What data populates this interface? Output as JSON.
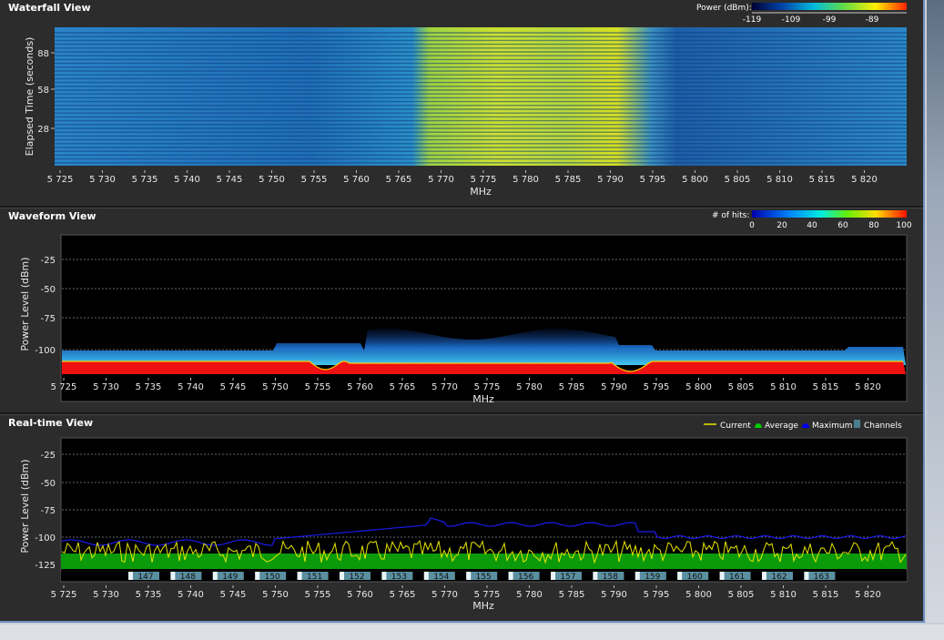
{
  "freq_ticks": [
    "5 725",
    "5 730",
    "5 735",
    "5 740",
    "5 745",
    "5 750",
    "5 755",
    "5 760",
    "5 765",
    "5 770",
    "5 775",
    "5 780",
    "5 785",
    "5 790",
    "5 795",
    "5 800",
    "5 805",
    "5 810",
    "5 815",
    "5 820"
  ],
  "waterfall": {
    "title": "Waterfall View",
    "ylabel": "Elapsed Time (seconds)",
    "xlabel": "MHz",
    "yticks": [
      "88",
      "58",
      "28"
    ],
    "legend_label": "Power (dBm):",
    "legend_ticks": [
      "-119",
      "-109",
      "-99",
      "-89"
    ]
  },
  "waveform": {
    "title": "Waveform View",
    "ylabel": "Power Level (dBm)",
    "xlabel": "MHz",
    "yticks": [
      "-25",
      "-50",
      "-75",
      "-100"
    ],
    "legend_label": "# of hits:",
    "legend_ticks": [
      "0",
      "20",
      "40",
      "60",
      "80",
      "100"
    ]
  },
  "realtime": {
    "title": "Real-time View",
    "ylabel": "Power Level (dBm)",
    "xlabel": "MHz",
    "yticks": [
      "-25",
      "-50",
      "-75",
      "-100",
      "-125"
    ],
    "legend": [
      {
        "label": "Current",
        "color": "#e6e600"
      },
      {
        "label": "Average",
        "color": "#00cc00"
      },
      {
        "label": "Maximum",
        "color": "#0000ee"
      },
      {
        "label": "Channels",
        "color": "#4a7f90"
      }
    ],
    "channels": [
      "147",
      "148",
      "149",
      "150",
      "151",
      "152",
      "153",
      "154",
      "155",
      "156",
      "157",
      "158",
      "159",
      "160",
      "161",
      "162",
      "163"
    ]
  }
}
